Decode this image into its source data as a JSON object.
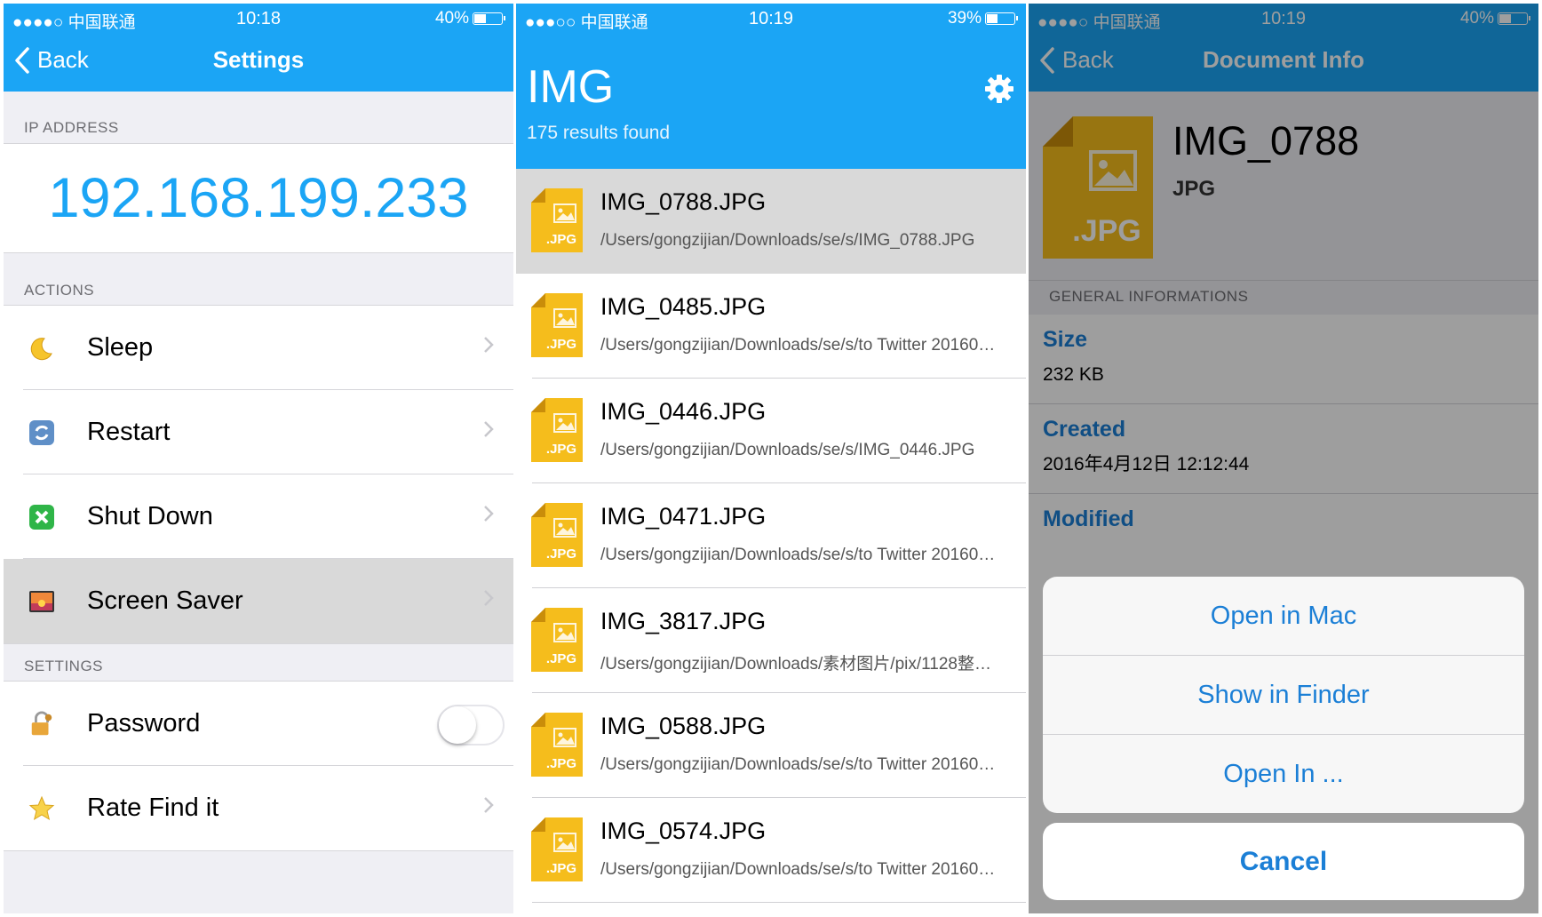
{
  "settings_screen": {
    "status": {
      "carrier": "●●●●○ 中国联通",
      "time": "10:18",
      "battery": "40%",
      "battery_level": 0.4
    },
    "nav": {
      "back": "Back",
      "title": "Settings"
    },
    "ip_header": "IP ADDRESS",
    "ip": "192.168.199.233",
    "actions_header": "ACTIONS",
    "actions": [
      {
        "label": "Sleep",
        "icon": "moon-icon"
      },
      {
        "label": "Restart",
        "icon": "restart-icon"
      },
      {
        "label": "Shut Down",
        "icon": "shutdown-icon"
      },
      {
        "label": "Screen Saver",
        "icon": "screen-saver-icon",
        "selected": true
      }
    ],
    "settings_header": "SETTINGS",
    "settings": [
      {
        "label": "Password",
        "icon": "lock-icon",
        "toggle": false
      },
      {
        "label": "Rate Find it",
        "icon": "star-icon"
      }
    ]
  },
  "results_screen": {
    "status": {
      "carrier": "●●●○○ 中国联通",
      "time": "10:19",
      "battery": "39%",
      "battery_level": 0.39
    },
    "title": "IMG",
    "subtitle": "175 results found",
    "icon_label": ".JPG",
    "files": [
      {
        "name": "IMG_0788.JPG",
        "path": "/Users/gongzijian/Downloads/se/s/IMG_0788.JPG",
        "selected": true
      },
      {
        "name": "IMG_0485.JPG",
        "path": "/Users/gongzijian/Downloads/se/s/to Twitter 20160…"
      },
      {
        "name": "IMG_0446.JPG",
        "path": "/Users/gongzijian/Downloads/se/s/IMG_0446.JPG"
      },
      {
        "name": "IMG_0471.JPG",
        "path": "/Users/gongzijian/Downloads/se/s/to Twitter 20160…"
      },
      {
        "name": "IMG_3817.JPG",
        "path": "/Users/gongzijian/Downloads/素材图片/pix/1128整…"
      },
      {
        "name": "IMG_0588.JPG",
        "path": "/Users/gongzijian/Downloads/se/s/to Twitter 20160…"
      },
      {
        "name": "IMG_0574.JPG",
        "path": "/Users/gongzijian/Downloads/se/s/to Twitter 20160…"
      }
    ]
  },
  "info_screen": {
    "status": {
      "carrier": "●●●●○ 中国联通",
      "time": "10:19",
      "battery": "40%",
      "battery_level": 0.4
    },
    "nav": {
      "back": "Back",
      "title": "Document Info"
    },
    "doc_name": "IMG_0788",
    "doc_type": "JPG",
    "icon_label": ".JPG",
    "general_header": "GENERAL INFORMATIONS",
    "fields": [
      {
        "key": "Size",
        "value": "232 KB"
      },
      {
        "key": "Created",
        "value": "2016年4月12日 12:12:44"
      },
      {
        "key": "Modified",
        "value": ""
      }
    ],
    "actions": [
      "Open in Mac",
      "Show in Finder",
      "Open In ..."
    ],
    "cancel": "Cancel"
  },
  "colors": {
    "accent": "#1ba5f5",
    "link": "#1b7fd6",
    "file_icon": "#f5bd1c"
  }
}
